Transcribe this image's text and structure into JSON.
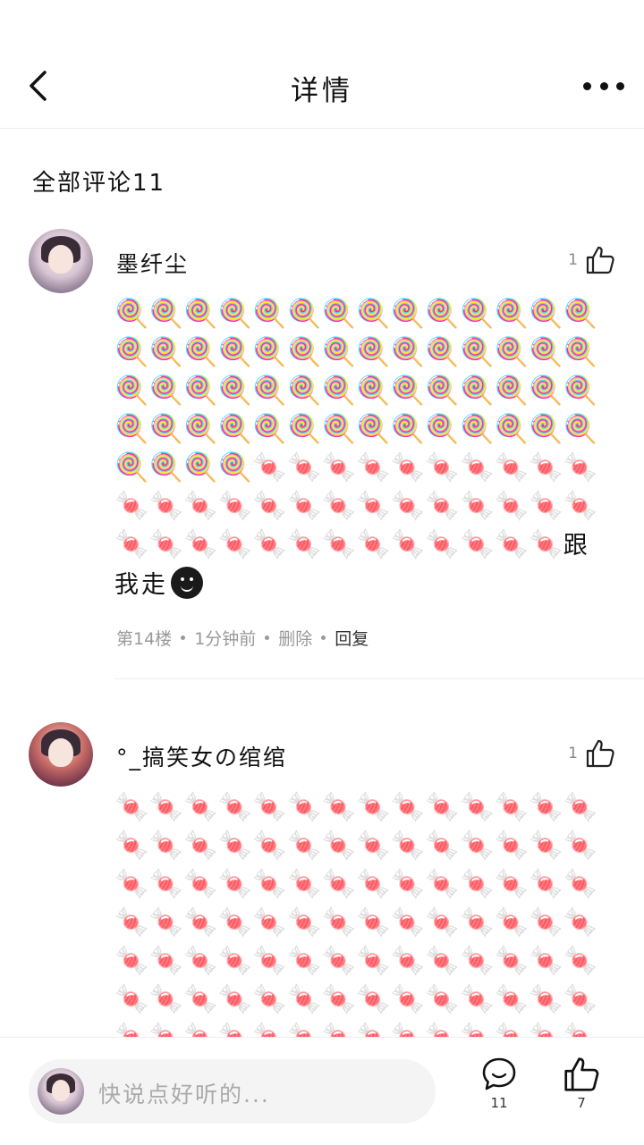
{
  "header": {
    "title": "详情"
  },
  "section": {
    "title": "全部评论11"
  },
  "comments": [
    {
      "username": "墨纤尘",
      "likes": "1",
      "emoji_a": "🍭",
      "emoji_a_count": 60,
      "emoji_b": "🍬",
      "emoji_b_count": 37,
      "text": "跟我走",
      "floor": "第14楼",
      "time": "1分钟前",
      "delete_label": "删除",
      "reply_label": "回复"
    },
    {
      "username": "°_搞笑女の绾绾",
      "likes": "1",
      "emoji_b": "🍬"
    }
  ],
  "bottom": {
    "placeholder": "快说点好听的...",
    "comment_count": "11",
    "like_count": "7"
  }
}
